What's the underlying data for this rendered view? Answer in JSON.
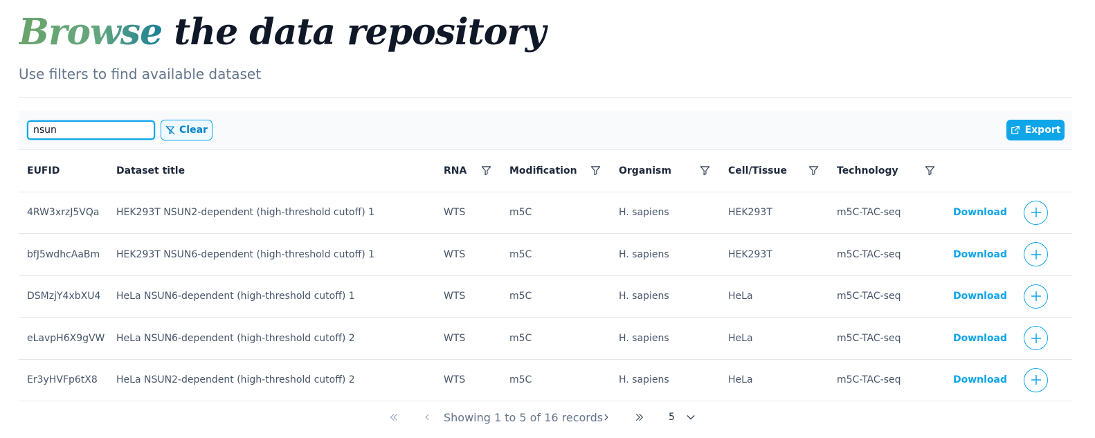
{
  "header": {
    "title_accent": "Browse",
    "title_rest": " the data repository",
    "subtitle": "Use filters to find available dataset"
  },
  "toolbar": {
    "search_value": "nsun",
    "clear_label": "Clear",
    "export_label": "Export"
  },
  "table": {
    "columns": {
      "eufid": "EUFID",
      "title": "Dataset title",
      "rna": "RNA",
      "modification": "Modification",
      "organism": "Organism",
      "cell": "Cell/Tissue",
      "technology": "Technology"
    },
    "download_label": "Download",
    "rows": [
      {
        "eufid": "4RW3xrzJ5VQa",
        "title": "HEK293T NSUN2-dependent (high-threshold cutoff) 1",
        "rna": "WTS",
        "modification": "m5C",
        "organism": "H. sapiens",
        "cell": "HEK293T",
        "technology": "m5C-TAC-seq"
      },
      {
        "eufid": "bfJ5wdhcAaBm",
        "title": "HEK293T NSUN6-dependent (high-threshold cutoff) 1",
        "rna": "WTS",
        "modification": "m5C",
        "organism": "H. sapiens",
        "cell": "HEK293T",
        "technology": "m5C-TAC-seq"
      },
      {
        "eufid": "DSMzjY4xbXU4",
        "title": "HeLa NSUN6-dependent (high-threshold cutoff) 1",
        "rna": "WTS",
        "modification": "m5C",
        "organism": "H. sapiens",
        "cell": "HeLa",
        "technology": "m5C-TAC-seq"
      },
      {
        "eufid": "eLavpH6X9gVW",
        "title": "HeLa NSUN6-dependent (high-threshold cutoff) 2",
        "rna": "WTS",
        "modification": "m5C",
        "organism": "H. sapiens",
        "cell": "HeLa",
        "technology": "m5C-TAC-seq"
      },
      {
        "eufid": "Er3yHVFp6tX8",
        "title": "HeLa NSUN2-dependent (high-threshold cutoff) 2",
        "rna": "WTS",
        "modification": "m5C",
        "organism": "H. sapiens",
        "cell": "HeLa",
        "technology": "m5C-TAC-seq"
      }
    ]
  },
  "paginator": {
    "report": "Showing 1 to 5 of 16 records",
    "rows_per_page": "5"
  },
  "colors": {
    "accent": "#0ea5e9",
    "title_gradient_start": "#6aa36a",
    "title_gradient_end": "#1b7f97"
  },
  "icons": {
    "clear": "filter-slash-icon",
    "export": "external-link-icon",
    "column_filter": "filter-icon",
    "add": "plus-icon",
    "first": "double-chevron-left-icon",
    "prev": "chevron-left-icon",
    "next": "chevron-right-icon",
    "last": "double-chevron-right-icon",
    "dropdown": "chevron-down-icon"
  }
}
